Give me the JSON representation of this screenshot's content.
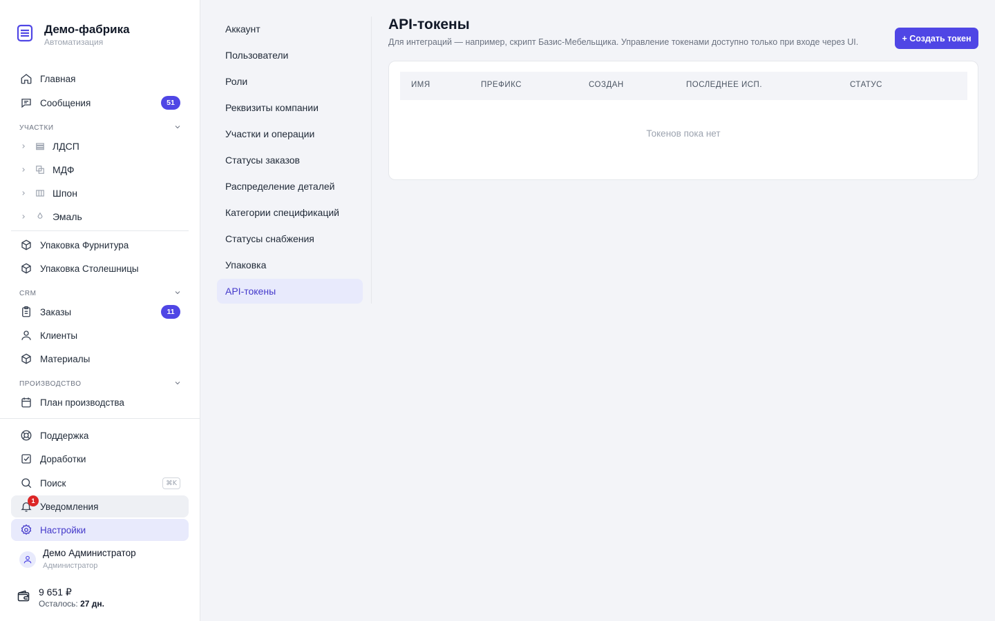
{
  "brand": {
    "title": "Демо-фабрика",
    "subtitle": "Автоматизация"
  },
  "nav": {
    "home": "Главная",
    "messages": "Сообщения",
    "messages_count": "51",
    "section_areas": "Участки",
    "areas": [
      "ЛДСП",
      "МДФ",
      "Шпон",
      "Эмаль"
    ],
    "pack_hardware": "Упаковка Фурнитура",
    "pack_tops": "Упаковка Столешницы",
    "section_crm": "CRM",
    "orders": "Заказы",
    "orders_count": "11",
    "clients": "Клиенты",
    "materials": "Материалы",
    "section_production": "Производство",
    "production_plan": "План производства",
    "support": "Поддержка",
    "improvements": "Доработки",
    "search": "Поиск",
    "search_shortcut": "⌘K",
    "notifications": "Уведомления",
    "notifications_count": "1",
    "settings": "Настройки"
  },
  "user": {
    "name": "Демо Администратор",
    "role": "Администратор"
  },
  "balance": {
    "amount": "9 651 ₽",
    "left_label": "Осталось: ",
    "left_value": "27 дн."
  },
  "settings_menu": [
    "Аккаунт",
    "Пользователи",
    "Роли",
    "Реквизиты компании",
    "Участки и операции",
    "Статусы заказов",
    "Распределение деталей",
    "Категории спецификаций",
    "Статусы снабжения",
    "Упаковка",
    "API-токены"
  ],
  "main": {
    "title": "API-токены",
    "description": "Для интеграций — например, скрипт Базис-Мебельщика. Управление токенами доступно только при входе через UI.",
    "create_button": "+ Создать токен",
    "columns": [
      "Имя",
      "Префикс",
      "Создан",
      "Последнее исп.",
      "Статус"
    ],
    "empty_text": "Токенов пока нет"
  },
  "colors": {
    "accent": "#4f46e5",
    "accent_bg": "#e8eafc",
    "danger": "#dc2626"
  }
}
